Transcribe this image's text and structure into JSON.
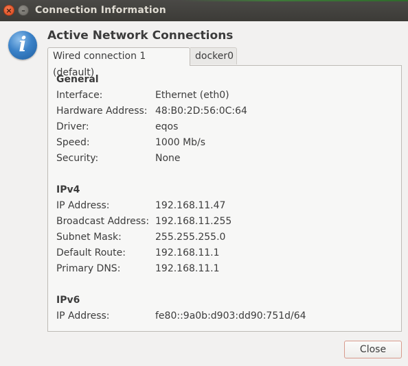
{
  "window": {
    "title": "Connection Information"
  },
  "dialog": {
    "heading": "Active Network Connections",
    "tabs": [
      {
        "label": "Wired connection 1 (default)",
        "active": true
      },
      {
        "label": "docker0",
        "active": false
      }
    ]
  },
  "general": {
    "title": "General",
    "rows": [
      {
        "label": "Interface:",
        "value": "Ethernet (eth0)"
      },
      {
        "label": "Hardware Address:",
        "value": "48:B0:2D:56:0C:64"
      },
      {
        "label": "Driver:",
        "value": "eqos"
      },
      {
        "label": "Speed:",
        "value": "1000 Mb/s"
      },
      {
        "label": "Security:",
        "value": "None"
      }
    ]
  },
  "ipv4": {
    "title": "IPv4",
    "rows": [
      {
        "label": "IP Address:",
        "value": "192.168.11.47"
      },
      {
        "label": "Broadcast Address:",
        "value": "192.168.11.255"
      },
      {
        "label": "Subnet Mask:",
        "value": "255.255.255.0"
      },
      {
        "label": "Default Route:",
        "value": "192.168.11.1"
      },
      {
        "label": "Primary DNS:",
        "value": "192.168.11.1"
      }
    ]
  },
  "ipv6": {
    "title": "IPv6",
    "rows": [
      {
        "label": "IP Address:",
        "value": "fe80::9a0b:d903:dd90:751d/64"
      }
    ]
  },
  "buttons": {
    "close_label": "Close"
  },
  "icons": {
    "titlebar_close": "close-icon",
    "titlebar_minimize": "minimize-icon",
    "dialog_info": "info-icon"
  }
}
